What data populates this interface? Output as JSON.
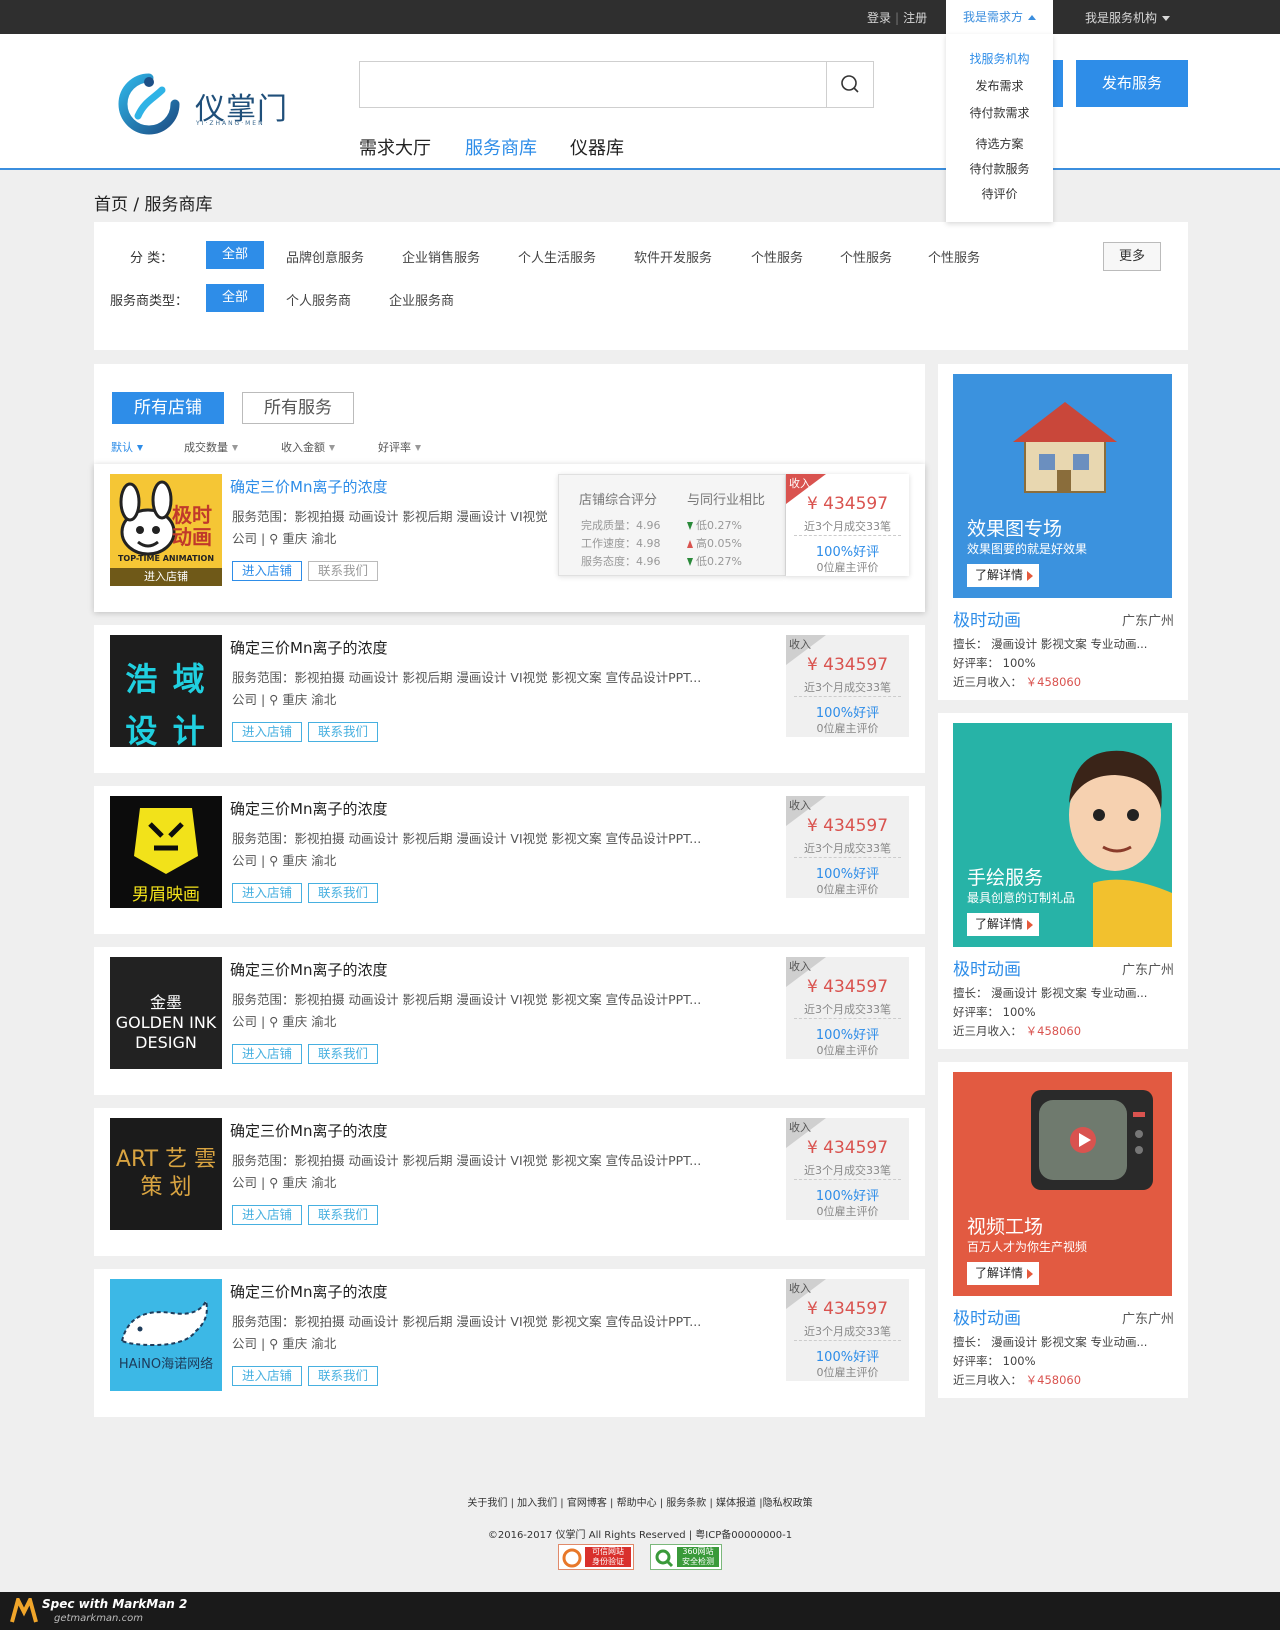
{
  "topbar": {
    "login": "登录",
    "register": "注册",
    "need_menu": "我是需求方",
    "org_menu": "我是服务机构"
  },
  "dropdown": [
    "找服务机构",
    "发布需求",
    "待付款需求",
    "待选方案",
    "待付款服务",
    "待评价"
  ],
  "logo": {
    "name": "仪掌门",
    "sub": "YI·ZHANG·MEN"
  },
  "search": {
    "placeholder": ""
  },
  "header_buttons": {
    "publish_service": "发布服务"
  },
  "nav": [
    "需求大厅",
    "服务商库",
    "仪器库"
  ],
  "breadcrumb": "首页 / 服务商库",
  "filter": {
    "category_label": "分 类：",
    "category_all": "全部",
    "categories": [
      "品牌创意服务",
      "企业销售服务",
      "个人生活服务",
      "软件开发服务",
      "个性服务",
      "个性服务",
      "个性服务"
    ],
    "more": "更多",
    "type_label": "服务商类型：",
    "type_all": "全部",
    "types": [
      "个人服务商",
      "企业服务商"
    ]
  },
  "tabs": {
    "shops": "所有店铺",
    "services": "所有服务"
  },
  "sort": [
    "默认",
    "成交数量",
    "收入金额",
    "好评率"
  ],
  "card_common": {
    "title": "确定三价Mn离子的浓度",
    "scope": "服务范围：影视拍摄 动画设计 影视后期 漫画设计 VI视觉 影视文案 宣传品设计PPT...",
    "scope_short": "服务范围：影视拍摄 动画设计 影视后期 漫画设计 VI视觉",
    "location": "公司 | ⚲ 重庆 渝北",
    "enter": "进入店铺",
    "contact": "联系我们",
    "income_label": "收入",
    "price": "¥ 434597",
    "deals": "近3个月成交33笔",
    "good": "100%好评",
    "employers": "0位雇主评价"
  },
  "first_card": {
    "thumb_caption": "进入店铺",
    "thumb_brand": "极时动画",
    "thumb_tag": "TOP-TIME ANIMATION"
  },
  "thumb_texts": [
    "浩 域 设 计",
    "男眉映画",
    "金墨 GOLDEN INK DESIGN",
    "ART 艺 雲 策 划",
    "HAiNO海诺网络"
  ],
  "rating_popup": {
    "head1": "店铺综合评分",
    "head2": "与同行业相比",
    "rows": [
      {
        "label": "完成质量：4.96",
        "cmp": "低0.27%",
        "dir": "down"
      },
      {
        "label": "工作速度：4.98",
        "cmp": "高0.05%",
        "dir": "up"
      },
      {
        "label": "服务态度：4.96",
        "cmp": "低0.27%",
        "dir": "down"
      }
    ]
  },
  "sidebar": [
    {
      "banner_title": "效果图专场",
      "banner_sub": "效果图要的就是好效果",
      "banner_btn": "了解详情",
      "bg": "#3b92de",
      "name": "极时动画",
      "loc": "广东广州",
      "skill": "擅长： 漫画设计  影视文案  专业动画...",
      "rate": "好评率： 100%",
      "income_label": "近三月收入：",
      "income": "￥458060"
    },
    {
      "banner_title": "手绘服务",
      "banner_sub": "最具创意的订制礼品",
      "banner_btn": "了解详情",
      "bg": "#27b3a7",
      "name": "极时动画",
      "loc": "广东广州",
      "skill": "擅长： 漫画设计  影视文案  专业动画...",
      "rate": "好评率： 100%",
      "income_label": "近三月收入：",
      "income": "￥458060"
    },
    {
      "banner_title": "视频工场",
      "banner_sub": "百万人才为你生产视频",
      "banner_btn": "了解详情",
      "bg": "#e25a41",
      "name": "极时动画",
      "loc": "广东广州",
      "skill": "擅长： 漫画设计  影视文案  专业动画...",
      "rate": "好评率： 100%",
      "income_label": "近三月收入：",
      "income": "￥458060"
    }
  ],
  "footer": {
    "links": "关于我们  |  加入我们  |  官网博客  |  帮助中心  |  服务条款  |  媒体报道  |隐私权政策",
    "copy": "©2016-2017 仪掌门 All Rights Reserved  |  粤ICP备00000000-1",
    "badge1_a": "可信网站",
    "badge1_b": "身份验证",
    "badge2_a": "360网站",
    "badge2_b": "安全检测"
  },
  "markman": {
    "line1": "Spec with MarkMan 2",
    "line2": "getmarkman.com"
  }
}
